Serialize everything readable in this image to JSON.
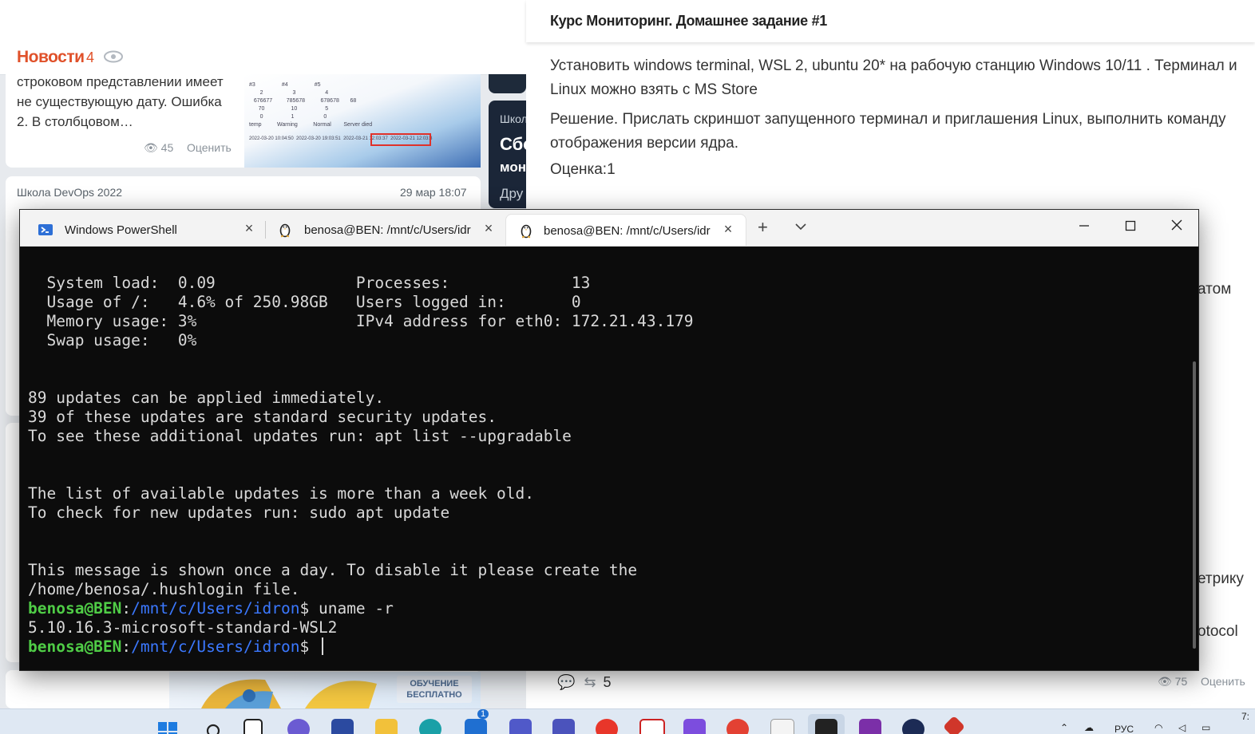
{
  "news": {
    "title": "Новости",
    "count": "4",
    "card1": {
      "text": "строковом представлении имеет не существующую дату. Ошибка 2. В столбцовом…",
      "views": "45",
      "rate": "Оценить",
      "thumb_rows": [
        "#3                 #4                 #5",
        "       2                   3                   4",
        "   676677         785678          678678       68",
        "      70                 10                  5",
        "       0                  1                   0",
        "temp          Warning          Normal        Server died",
        "2022-03-20 10:04:50  2022-03-20 19:03:51  2022-03-21 12:03:37  2022-03-21 12:03:3"
      ]
    },
    "card2": {
      "source": "Школа DevOps 2022",
      "date": "29 мар 18:07"
    },
    "dark_card": {
      "t1": "Школ",
      "t2": "Сбо",
      "t3": "мон",
      "t4": "Дру"
    },
    "promo_badge": "ОБУЧЕНИЕ БЕСПЛАТНО"
  },
  "doc": {
    "title": "Курс Мониторинг. Домашнее задание #1",
    "p1": "Установить windows terminal, WSL 2, ubuntu 20* на рабочую станцию Windows 10/11 . Терминал и Linux можно взять с MS Store",
    "p2": "Решение. Прислать скриншот запущенного терминал и приглашения Linux, выполнить команду отображения версии ядра.",
    "p3": "Оценка:1",
    "frag1": "атом",
    "frag2": "етрику",
    "frag3": "otocol",
    "foot_count": "5",
    "foot_views": "75",
    "foot_rate": "Оценить"
  },
  "terminal": {
    "tabs": [
      {
        "label": "Windows PowerShell",
        "icon": "powershell-icon"
      },
      {
        "label": "benosa@BEN: /mnt/c/Users/idr",
        "icon": "linux-penguin-icon"
      },
      {
        "label": "benosa@BEN: /mnt/c/Users/idr",
        "icon": "linux-penguin-icon",
        "active": true
      }
    ],
    "lines": [
      "  System load:  0.09               Processes:             13",
      "  Usage of /:   4.6% of 250.98GB   Users logged in:       0",
      "  Memory usage: 3%                 IPv4 address for eth0: 172.21.43.179",
      "  Swap usage:   0%",
      "",
      "",
      "89 updates can be applied immediately.",
      "39 of these updates are standard security updates.",
      "To see these additional updates run: apt list --upgradable",
      "",
      "",
      "The list of available updates is more than a week old.",
      "To check for new updates run: sudo apt update",
      "",
      "",
      "This message is shown once a day. To disable it please create the",
      "/home/benosa/.hushlogin file."
    ],
    "prompt_user": "benosa@BEN",
    "prompt_path": "/mnt/c/Users/idron",
    "prompt_sign": "$",
    "command": " uname -r",
    "output": "5.10.16.3-microsoft-standard-WSL2"
  },
  "taskbar": {
    "badge": "1",
    "lang": "РУС",
    "time": "7:"
  },
  "colors": {
    "news_accent": "#e0512a",
    "prompt_green": "#4fcc46",
    "prompt_blue": "#3b78ff",
    "terminal_bg": "#0c0c0c"
  }
}
